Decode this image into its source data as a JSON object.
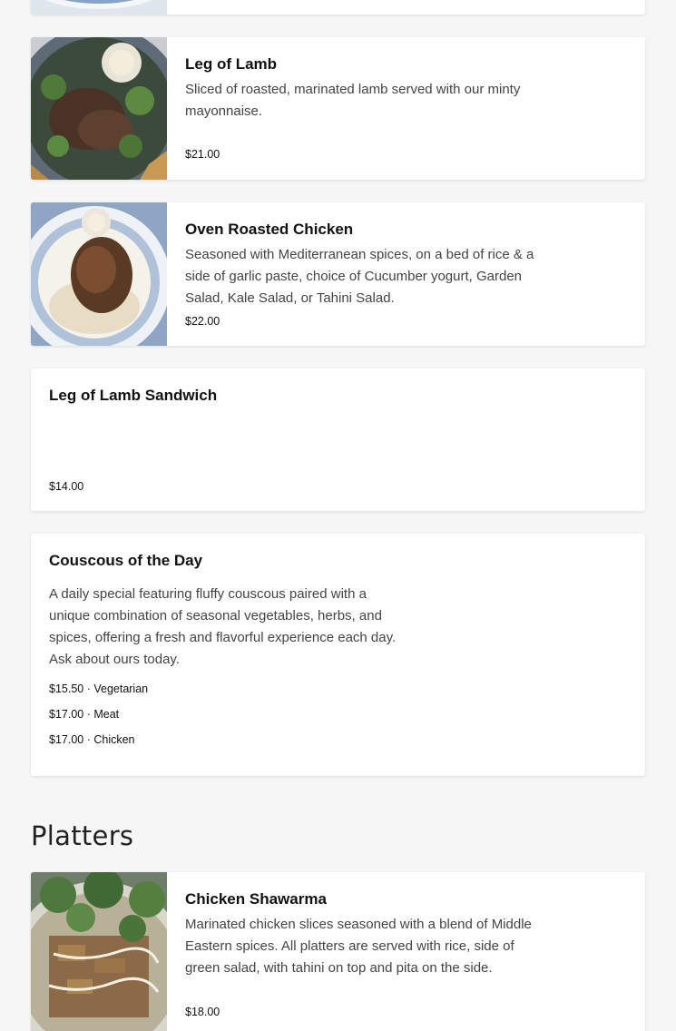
{
  "sections": [
    {
      "items": [
        {
          "name": "Leg of Lamb",
          "description": "Sliced of roasted, marinated lamb served with our minty mayonnaise.",
          "price": "$21.00"
        },
        {
          "name": "Oven Roasted Chicken",
          "description": "Seasoned with Mediterranean spices, on a bed of rice & a side of garlic paste, choice of Cucumber yogurt, Garden Salad, Kale Salad, or Tahini Salad.",
          "price": "$22.00"
        },
        {
          "name": "Leg of Lamb Sandwich",
          "price": "$14.00"
        },
        {
          "name": "Couscous of the Day",
          "description": "A daily special featuring fluffy couscous paired with a unique combination of seasonal vegetables, herbs, and spices, offering a fresh and flavorful experience each day. Ask about ours today.",
          "options": [
            "$15.50 · Vegetarian",
            "$17.00 · Meat",
            "$17.00 · Chicken"
          ]
        }
      ]
    },
    {
      "title": "Platters",
      "items": [
        {
          "name": "Chicken Shawarma",
          "description": "Marinated chicken slices seasoned with a blend of Middle Eastern spices. All platters are served with rice, side of green salad, with tahini on top and pita on the side.",
          "price": "$18.00"
        }
      ]
    }
  ]
}
